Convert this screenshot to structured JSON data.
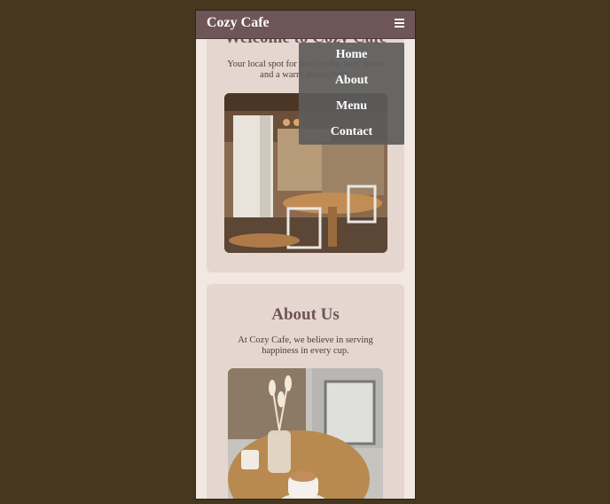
{
  "header": {
    "brand": "Cozy Cafe",
    "menu_icon": "hamburger-icon"
  },
  "nav": {
    "items": [
      {
        "label": "Home"
      },
      {
        "label": "About"
      },
      {
        "label": "Menu"
      },
      {
        "label": "Contact"
      }
    ]
  },
  "welcome": {
    "title": "Welcome to Cozy Cafe",
    "text": "Your local spot for fresh coffe, tasty treats and a warm atmosphere."
  },
  "about": {
    "title": "About Us",
    "text": "At Cozy Cafe, we believe in serving happiness in every cup."
  },
  "colors": {
    "page_bg": "#45381f",
    "header": "#6e5557",
    "card": "#e5d7cf",
    "accent_text": "#6e5557"
  }
}
